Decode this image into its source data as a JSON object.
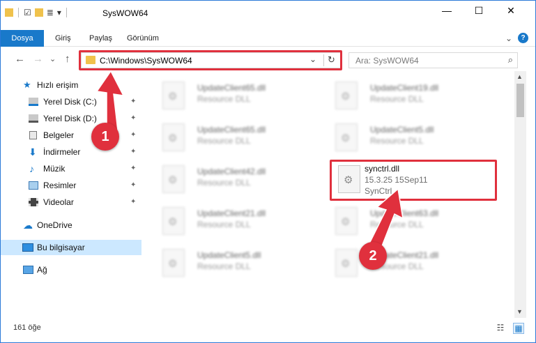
{
  "window": {
    "title": "SysWOW64"
  },
  "ribbon": {
    "tabs": [
      "Dosya",
      "Giriş",
      "Paylaş",
      "Görünüm"
    ],
    "expand_glyph": "⌄",
    "help_glyph": "?"
  },
  "quick_access": {
    "folder_glyph": "▮",
    "check_glyph": "☑",
    "props_glyph": "≣",
    "menu_glyph": "▾"
  },
  "window_controls": {
    "minimize": "—",
    "maximize": "☐",
    "close": "✕"
  },
  "nav_buttons": {
    "back": "←",
    "forward": "→",
    "history": "⌄",
    "up": "↑"
  },
  "address": {
    "path": "C:\\Windows\\SysWOW64",
    "chevron": "⌄",
    "refresh": "↻"
  },
  "search": {
    "placeholder": "Ara: SysWOW64",
    "icon": "⌕"
  },
  "nav_pane": {
    "pin_glyph": "✦",
    "items": [
      {
        "label": "Hızlı erişim"
      },
      {
        "label": "Yerel Disk (C:)"
      },
      {
        "label": "Yerel Disk (D:)"
      },
      {
        "label": "Belgeler"
      },
      {
        "label": "İndirmeler"
      },
      {
        "label": "Müzik"
      },
      {
        "label": "Resimler"
      },
      {
        "label": "Videolar"
      },
      {
        "label": "OneDrive"
      },
      {
        "label": "Bu bilgisayar"
      },
      {
        "label": "Ağ"
      }
    ]
  },
  "files": [
    {
      "name": "UpdateClient65.dll",
      "desc": "Resource DLL"
    },
    {
      "name": "UpdateClient19.dll",
      "desc": "Resource DLL"
    },
    {
      "name": "UpdateClient65.dll",
      "desc": "Resource DLL"
    },
    {
      "name": "UpdateClient5.dll",
      "desc": "Resource DLL"
    },
    {
      "name": "UpdateClient42.dll",
      "desc": "Resource DLL"
    },
    {
      "name": "synctrl.dll",
      "version": "15.3.25 15Sep11",
      "desc": "SynCtrl"
    },
    {
      "name": "UpdateClient21.dll",
      "desc": "Resource DLL"
    },
    {
      "name": "UpdateClient63.dll",
      "desc": "Resource DLL"
    },
    {
      "name": "UpdateClient5.dll",
      "desc": "Resource DLL"
    },
    {
      "name": "UpdateClient21.dll",
      "desc": "Resource DLL"
    }
  ],
  "file_icon_glyph": "⚙",
  "scrollbar": {
    "up": "▲",
    "down": "▼"
  },
  "status": {
    "item_count": "161 öğe",
    "details_glyph": "☷",
    "tiles_glyph": "▦"
  },
  "callouts": {
    "one": "1",
    "two": "2"
  },
  "colors": {
    "accent": "#1979ca",
    "highlight": "#e0303d",
    "selected": "#cce8ff"
  }
}
